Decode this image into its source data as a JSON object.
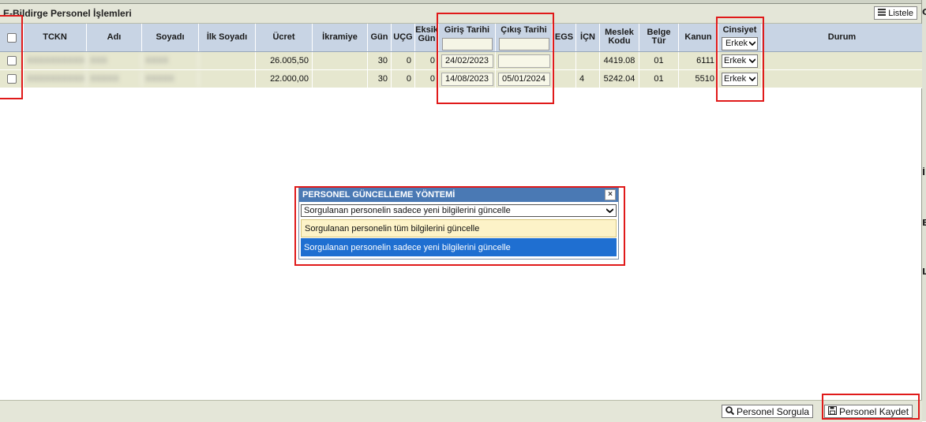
{
  "title": "E-Bildirge Personel İşlemleri",
  "listele_label": "Listele",
  "edge_letters": [
    "G",
    "İ",
    "E",
    "L"
  ],
  "columns": {
    "tckn": "TCKN",
    "adi": "Adı",
    "soyadi": "Soyadı",
    "ilk_soyadi": "İlk Soyadı",
    "ucret": "Ücret",
    "ikramiye": "İkramiye",
    "gun": "Gün",
    "ucg": "UÇG",
    "eksik_gun_1": "Eksik",
    "eksik_gun_2": "Gün",
    "giris": "Giriş Tarihi",
    "cikis": "Çıkış Tarihi",
    "egs": "EGS",
    "icn": "İÇN",
    "meslek_1": "Meslek",
    "meslek_2": "Kodu",
    "belge_1": "Belge",
    "belge_2": "Tür",
    "kanun": "Kanun",
    "cinsiyet": "Cinsiyet",
    "durum": "Durum"
  },
  "header_cinsiyet_value": "Erkek",
  "rows": [
    {
      "tckn": "XXXXXXXXXX",
      "adi": "XXX",
      "soyadi": "XXXX",
      "ucret": "26.005,50",
      "gun": "30",
      "ucg": "0",
      "eksik": "0",
      "giris": "24/02/2023",
      "cikis": "",
      "egs": "",
      "icn": "",
      "meslek": "4419.08",
      "belge": "01",
      "kanun": "6111",
      "cinsiyet": "Erkek"
    },
    {
      "tckn": "XXXXXXXXXX",
      "adi": "XXXXX",
      "soyadi": "XXXXX",
      "ucret": "22.000,00",
      "gun": "30",
      "ucg": "0",
      "eksik": "0",
      "giris": "14/08/2023",
      "cikis": "05/01/2024",
      "egs": "",
      "icn": "4",
      "meslek": "5242.04",
      "belge": "01",
      "kanun": "5510",
      "cinsiyet": "Erkek"
    }
  ],
  "dialog": {
    "title": "PERSONEL GÜNCELLEME YÖNTEMİ",
    "close": "×",
    "selected": "Sorgulanan personelin sadece yeni bilgilerini güncelle",
    "options": [
      "Sorgulanan personelin tüm bilgilerini güncelle",
      "Sorgulanan personelin sadece yeni bilgilerini güncelle"
    ]
  },
  "buttons": {
    "sorgula": "Personel Sorgula",
    "kaydet": "Personel Kaydet"
  },
  "colors": {
    "header": "#c8d4e4",
    "row": "#e6e7cf",
    "highlight": "#e01a1a",
    "selected_option": "#1f6fd1"
  }
}
